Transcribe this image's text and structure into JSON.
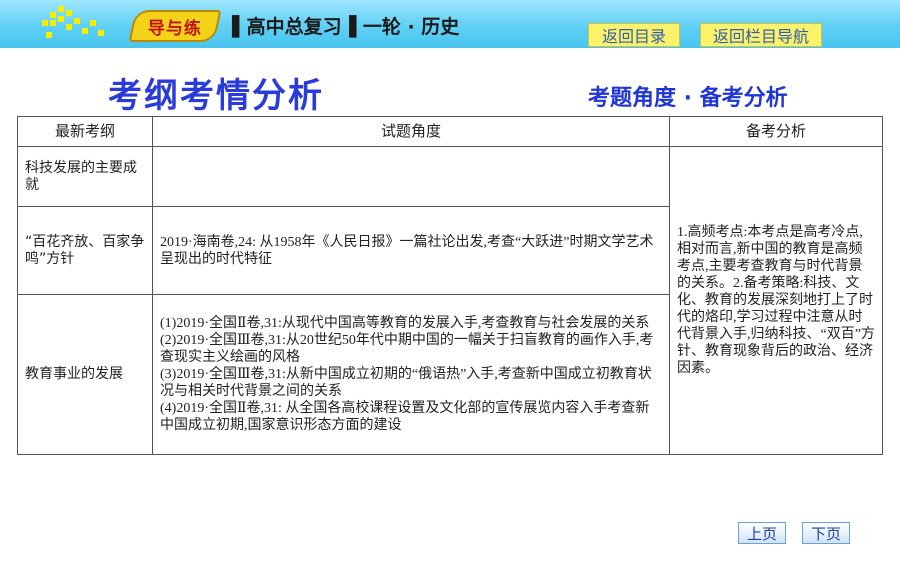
{
  "header": {
    "logo": "导与练",
    "subject": "▌高中总复习▐ 一轮 · 历史",
    "back_to_contents": "返回目录",
    "back_to_section_nav": "返回栏目导航"
  },
  "page": {
    "title": "考纲考情分析",
    "subtitle": "考题角度 · 备考分析"
  },
  "table": {
    "headers": [
      "最新考纲",
      "试题角度",
      "备考分析"
    ],
    "rows": [
      {
        "syllabus": "科技发展的主要成就",
        "angle": ""
      },
      {
        "syllabus": "“百花齐放、百家争鸣”方针",
        "angle": "2019·海南卷,24: 从1958年《人民日报》一篇社论出发,考查“大跃进”时期文学艺术呈现出的时代特征"
      },
      {
        "syllabus": "教育事业的发展",
        "angle_items": [
          "(1)2019·全国Ⅱ卷,31:从现代中国高等教育的发展入手,考查教育与社会发展的关系",
          "(2)2019·全国Ⅲ卷,31:从20世纪50年代中期中国的一幅关于扫盲教育的画作入手,考查现实主义绘画的风格",
          "(3)2019·全国Ⅲ卷,31:从新中国成立初期的“俄语热”入手,考查新中国成立初教育状况与相关时代背景之间的关系",
          "(4)2019·全国Ⅱ卷,31: 从全国各高校课程设置及文化部的宣传展览内容入手考查新中国成立初期,国家意识形态方面的建设"
        ]
      }
    ],
    "analysis": "1.高频考点:本考点是高考冷点,相对而言,新中国的教育是高频考点,主要考查教育与时代背景的关系。2.备考策略:科技、文化、教育的发展深刻地打上了时代的烙印,学习过程中注意从时代背景入手,归纳科技、“双百”方针、教育现象背后的政治、经济因素。"
  },
  "pager": {
    "prev": "上页",
    "next": "下页"
  },
  "colors": {
    "title_blue": "#2a3bdc",
    "header_cyan": "#5fd0f4",
    "button_yellow": "#fbf26a"
  }
}
